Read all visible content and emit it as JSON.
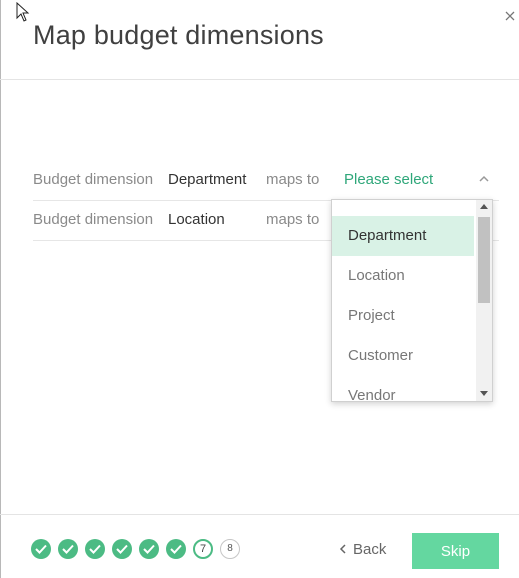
{
  "dialog": {
    "title": "Map budget dimensions",
    "close_icon": "close-icon"
  },
  "rows": [
    {
      "label": "Budget dimension",
      "dimension": "Department",
      "maps_to": "maps to",
      "value": "Please select"
    },
    {
      "label": "Budget dimension",
      "dimension": "Location",
      "maps_to": "maps to",
      "value": ""
    }
  ],
  "dropdown": {
    "options": [
      "Department",
      "Location",
      "Project",
      "Customer",
      "Vendor"
    ],
    "highlighted": "Department"
  },
  "footer": {
    "completed_steps": 6,
    "current_step": "7",
    "next_step": "8",
    "back_label": "Back",
    "skip_label": "Skip"
  },
  "colors": {
    "accent": "#2fa77a",
    "step_done": "#4cbb84",
    "skip_button": "#64d7a0",
    "option_highlight": "#d9f2e6"
  }
}
